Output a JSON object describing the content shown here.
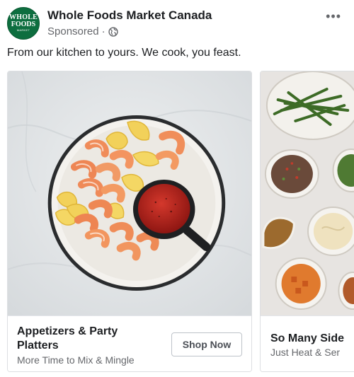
{
  "post": {
    "page_name": "Whole Foods Market Canada",
    "sponsored": "Sponsored",
    "separator": "·",
    "more_label": "•••",
    "caption": "From our kitchen to yours. We cook, you feast.",
    "logo": {
      "line1": "WHOLE",
      "line2": "FOODS",
      "line3": "MARKET"
    }
  },
  "carousel": {
    "cards": [
      {
        "title": "Appetizers & Party Platters",
        "subtitle": "More Time to Mix & Mingle",
        "cta": "Shop Now",
        "image": "shrimp-cocktail-platter"
      },
      {
        "title": "So Many Side",
        "subtitle": "Just Heat & Ser",
        "image": "side-dishes-spread"
      }
    ]
  },
  "colors": {
    "brand_green": "#0d6e3f",
    "text_primary": "#1c1e21",
    "text_secondary": "#65676b"
  }
}
